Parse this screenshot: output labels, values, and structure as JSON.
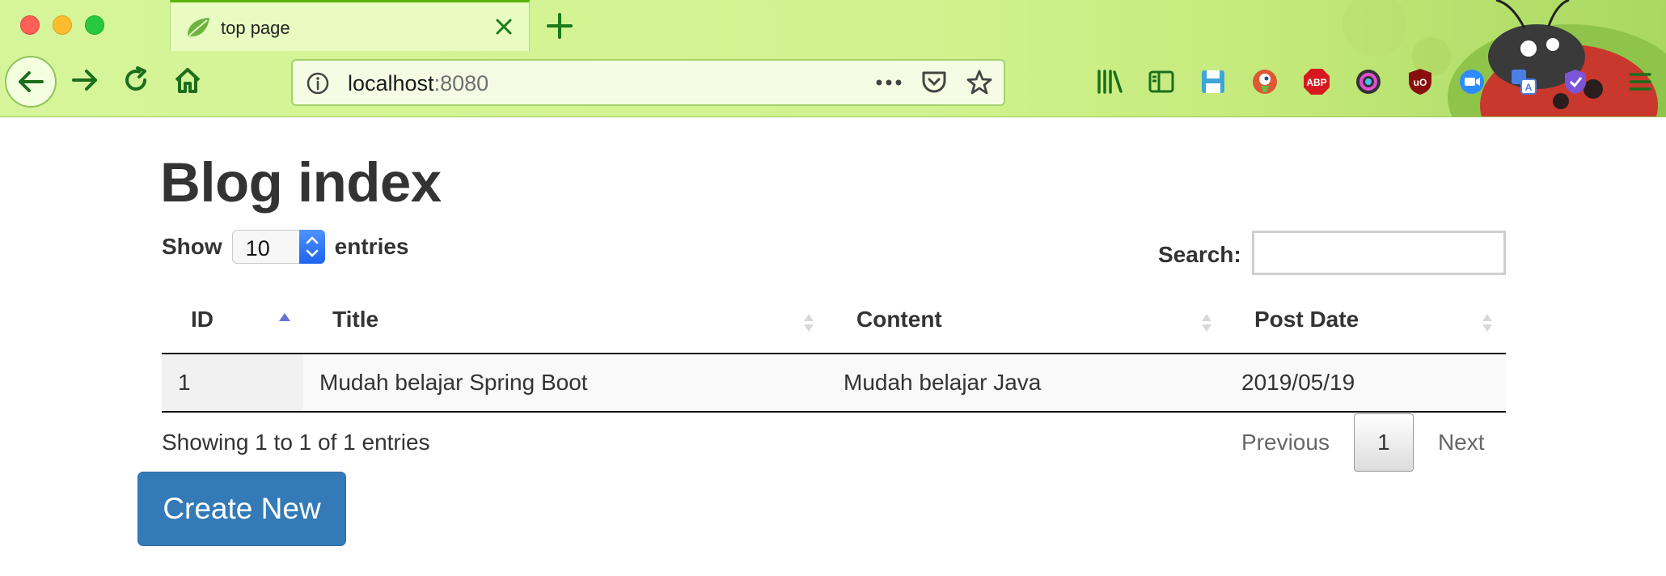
{
  "browser": {
    "tab_title": "top page",
    "url_host": "localhost",
    "url_port": ":8080",
    "theme_color": "#d2f28f",
    "accent_color": "#59b400"
  },
  "page": {
    "title": "Blog index",
    "show_label": "Show",
    "entries_select_value": "10",
    "entries_label": "entries",
    "search_label": "Search:",
    "search_value": "",
    "table": {
      "columns": [
        "ID",
        "Title",
        "Content",
        "Post Date"
      ],
      "sorted_column": "ID",
      "sort_direction": "ascending",
      "rows": [
        {
          "id": "1",
          "title": "Mudah belajar Spring Boot",
          "content": "Mudah belajar Java",
          "post_date": "2019/05/19"
        }
      ]
    },
    "info_text": "Showing 1 to 1 of 1 entries",
    "pagination": {
      "previous": "Previous",
      "current": "1",
      "next": "Next"
    },
    "create_button": "Create New",
    "primary_color": "#337ab7"
  }
}
